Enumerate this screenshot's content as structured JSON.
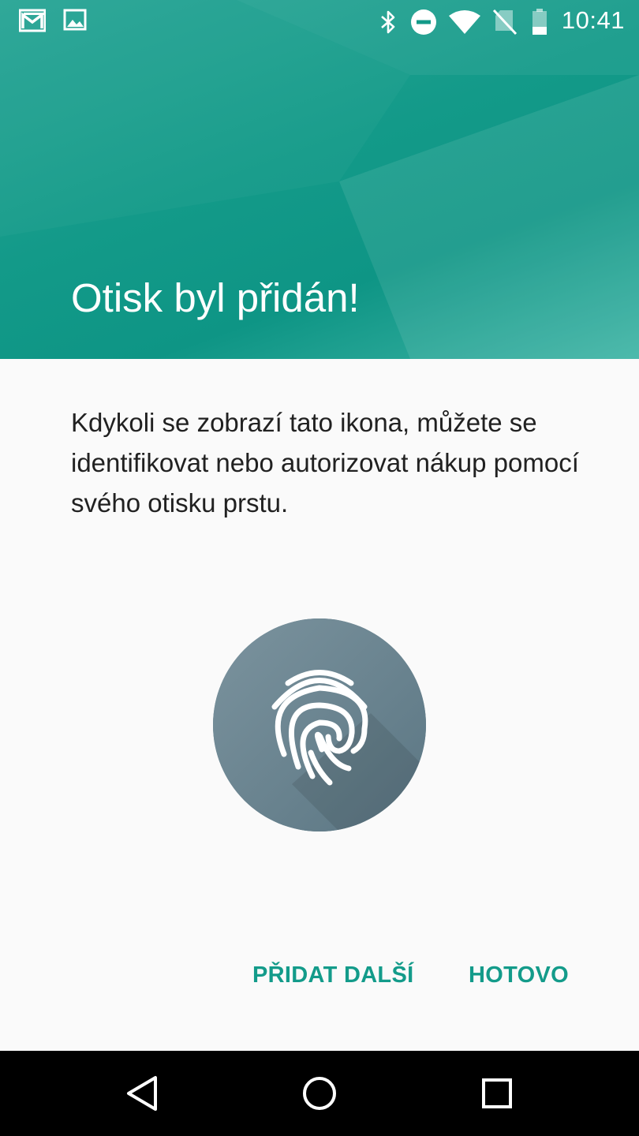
{
  "status_bar": {
    "time": "10:41",
    "left_icons": [
      "gmail-icon",
      "gallery-icon"
    ],
    "right_icons": [
      "bluetooth-icon",
      "do-not-disturb-icon",
      "wifi-icon",
      "no-sim-icon",
      "battery-icon"
    ]
  },
  "header": {
    "title": "Otisk byl přidán!",
    "color": "#139a89"
  },
  "body": {
    "description": "Kdykoli se zobrazí tato ikona, můžete se identifikovat nebo autorizovat nákup pomocí svého otisku prstu.",
    "icon": "fingerprint-icon",
    "icon_color": "#5f7a87"
  },
  "actions": {
    "add_another": "PŘIDAT DALŠÍ",
    "done": "HOTOVO",
    "accent": "#139b8a"
  },
  "nav_bar": {
    "icons": [
      "back-icon",
      "home-icon",
      "recents-icon"
    ]
  }
}
